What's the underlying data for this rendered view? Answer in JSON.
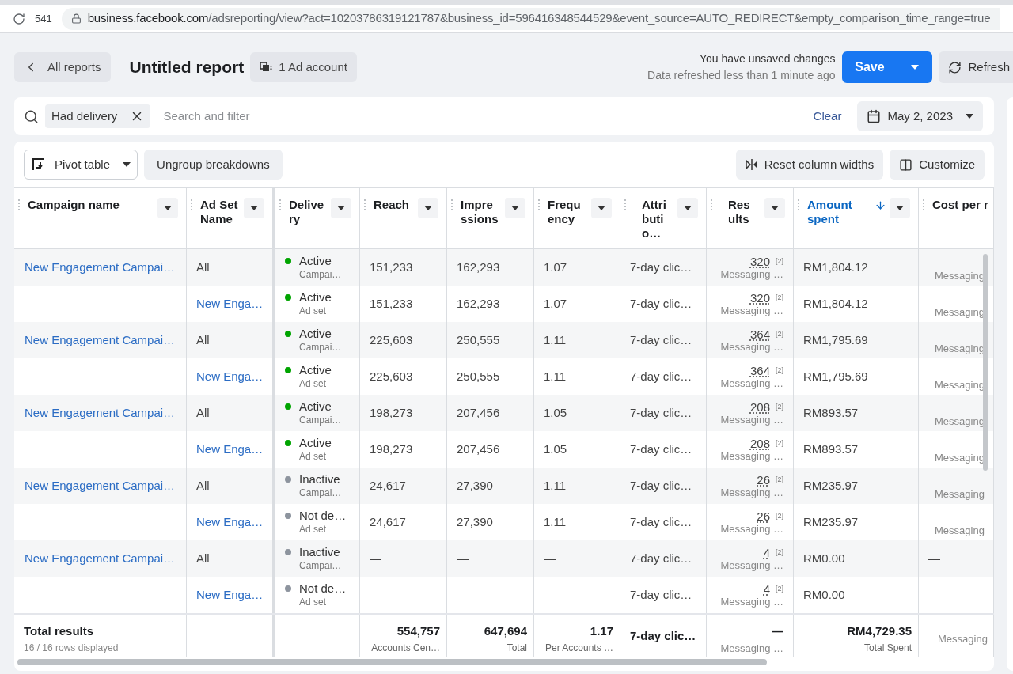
{
  "browser": {
    "tab_count": "541",
    "url_host": "business.facebook.com",
    "url_path": "/adsreporting/view?act=10203786319121787&business_id=596416348544529&event_source=AUTO_REDIRECT&empty_comparison_time_range=true"
  },
  "header": {
    "back": "All reports",
    "title": "Untitled report",
    "account": "1 Ad account",
    "unsaved": "You have unsaved changes",
    "refreshed": "Data refreshed less than 1 minute ago",
    "save": "Save",
    "refresh": "Refresh"
  },
  "filter": {
    "chip": "Had delivery",
    "placeholder": "Search and filter",
    "clear": "Clear",
    "date": "May 2, 2023"
  },
  "toolbar": {
    "pivot": "Pivot table",
    "ungroup": "Ungroup breakdowns",
    "reset": "Reset column widths",
    "customize": "Customize"
  },
  "columns": [
    {
      "lines": [
        "Campaign name"
      ],
      "sorted": false
    },
    {
      "lines": [
        "Ad Set",
        "Name"
      ],
      "sorted": false
    },
    {
      "lines": [
        "Delive",
        "ry"
      ],
      "sorted": false
    },
    {
      "lines": [
        "Reach"
      ],
      "sorted": false
    },
    {
      "lines": [
        "Impre",
        "ssions"
      ],
      "sorted": false
    },
    {
      "lines": [
        "Frequ",
        "ency"
      ],
      "sorted": false
    },
    {
      "lines": [
        "Attri",
        "buti",
        "o…"
      ],
      "sorted": false
    },
    {
      "lines": [
        "Res",
        "ults"
      ],
      "sorted": false
    },
    {
      "lines": [
        "Amount",
        "spent"
      ],
      "sorted": true
    },
    {
      "lines": [
        "Cost per r"
      ],
      "sorted": false
    }
  ],
  "rows": [
    {
      "kind": "campaign",
      "campaign": "New Engagement Campai…",
      "ad_set": "All",
      "status": "Active",
      "color": "#00a400",
      "level_name": "Campai…",
      "reach": "151,233",
      "impressions": "162,293",
      "frequency": "1.07",
      "attribution": "7-day clic…",
      "results": "320",
      "results_note": "[2]",
      "results_sub": "Messaging …",
      "amount": "RM1,804.12",
      "cost": "Messaging"
    },
    {
      "kind": "ad_set",
      "ad_set": "New Enga…",
      "status": "Active",
      "color": "#00a400",
      "level_name": "Ad set",
      "reach": "151,233",
      "impressions": "162,293",
      "frequency": "1.07",
      "attribution": "7-day clic…",
      "results": "320",
      "results_note": "[2]",
      "results_sub": "Messaging …",
      "amount": "RM1,804.12",
      "cost": "Messaging"
    },
    {
      "kind": "campaign",
      "campaign": "New Engagement Campai…",
      "ad_set": "All",
      "status": "Active",
      "color": "#00a400",
      "level_name": "Campai…",
      "reach": "225,603",
      "impressions": "250,555",
      "frequency": "1.11",
      "attribution": "7-day clic…",
      "results": "364",
      "results_note": "[2]",
      "results_sub": "Messaging …",
      "amount": "RM1,795.69",
      "cost": "Messaging"
    },
    {
      "kind": "ad_set",
      "ad_set": "New Enga…",
      "status": "Active",
      "color": "#00a400",
      "level_name": "Ad set",
      "reach": "225,603",
      "impressions": "250,555",
      "frequency": "1.11",
      "attribution": "7-day clic…",
      "results": "364",
      "results_note": "[2]",
      "results_sub": "Messaging …",
      "amount": "RM1,795.69",
      "cost": "Messaging"
    },
    {
      "kind": "campaign",
      "campaign": "New Engagement Campai…",
      "ad_set": "All",
      "status": "Active",
      "color": "#00a400",
      "level_name": "Campai…",
      "reach": "198,273",
      "impressions": "207,456",
      "frequency": "1.05",
      "attribution": "7-day clic…",
      "results": "208",
      "results_note": "[2]",
      "results_sub": "Messaging …",
      "amount": "RM893.57",
      "cost": "Messaging"
    },
    {
      "kind": "ad_set",
      "ad_set": "New Enga…",
      "status": "Active",
      "color": "#00a400",
      "level_name": "Ad set",
      "reach": "198,273",
      "impressions": "207,456",
      "frequency": "1.05",
      "attribution": "7-day clic…",
      "results": "208",
      "results_note": "[2]",
      "results_sub": "Messaging …",
      "amount": "RM893.57",
      "cost": "Messaging"
    },
    {
      "kind": "campaign",
      "campaign": "New Engagement Campai…",
      "ad_set": "All",
      "status": "Inactive",
      "color": "#8d949e",
      "level_name": "Campai…",
      "reach": "24,617",
      "impressions": "27,390",
      "frequency": "1.11",
      "attribution": "7-day clic…",
      "results": "26",
      "results_note": "[2]",
      "results_sub": "Messaging …",
      "amount": "RM235.97",
      "cost": "Messaging"
    },
    {
      "kind": "ad_set",
      "ad_set": "New Enga…",
      "status": "Not de…",
      "color": "#8d949e",
      "level_name": "Ad set",
      "reach": "24,617",
      "impressions": "27,390",
      "frequency": "1.11",
      "attribution": "7-day clic…",
      "results": "26",
      "results_note": "[2]",
      "results_sub": "Messaging …",
      "amount": "RM235.97",
      "cost": "Messaging"
    },
    {
      "kind": "campaign",
      "campaign": "New Engagement Campai…",
      "ad_set": "All",
      "status": "Inactive",
      "color": "#8d949e",
      "level_name": "Campai…",
      "reach": "—",
      "impressions": "—",
      "frequency": "—",
      "attribution": "7-day clic…",
      "results": "4",
      "results_note": "[2]",
      "results_sub": "Messaging …",
      "amount": "RM0.00",
      "cost": "—"
    },
    {
      "kind": "ad_set",
      "ad_set": "New Enga…",
      "status": "Not de…",
      "color": "#8d949e",
      "level_name": "Ad set",
      "reach": "—",
      "impressions": "—",
      "frequency": "—",
      "attribution": "7-day clic…",
      "results": "4",
      "results_note": "[2]",
      "results_sub": "Messaging …",
      "amount": "RM0.00",
      "cost": "—"
    }
  ],
  "totals": {
    "label": "Total results",
    "rows_displayed": "16 / 16 rows displayed",
    "reach": "554,757",
    "reach_sub": "Accounts Cen…",
    "impressions": "647,694",
    "impressions_sub": "Total",
    "frequency": "1.17",
    "frequency_sub": "Per Accounts …",
    "attribution": "7-day clic…",
    "results": "—",
    "results_sub": "Messaging …",
    "amount": "RM4,729.35",
    "amount_sub": "Total Spent",
    "cost_sub": "Messaging"
  }
}
